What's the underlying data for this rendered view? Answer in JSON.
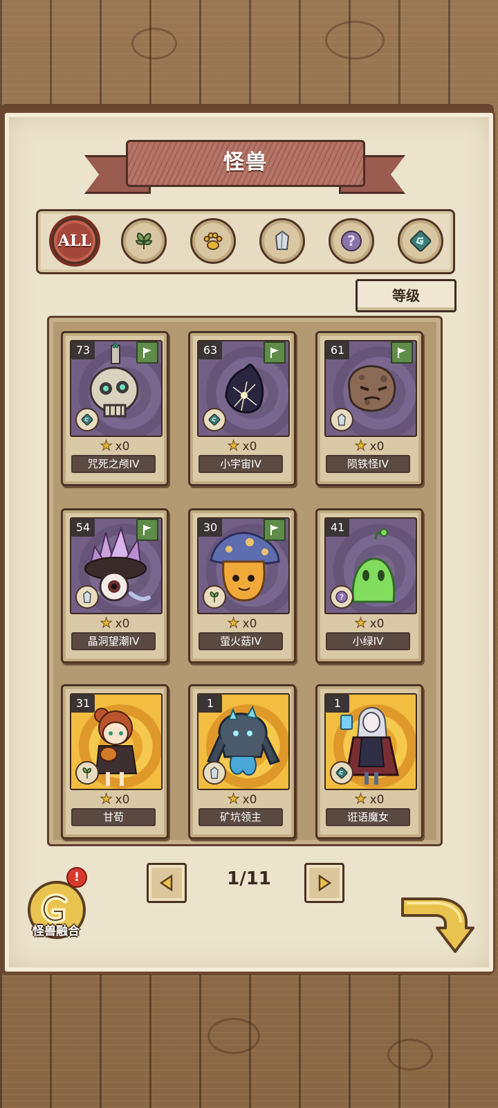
{
  "title": "怪兽",
  "tabs": [
    {
      "label": "ALL",
      "icon": "all-icon",
      "active": true
    },
    {
      "label": "",
      "icon": "leaf-icon",
      "active": false
    },
    {
      "label": "",
      "icon": "paw-icon",
      "active": false
    },
    {
      "label": "",
      "icon": "crystal-icon",
      "active": false
    },
    {
      "label": "",
      "icon": "question-icon",
      "active": false
    },
    {
      "label": "",
      "icon": "rune-icon",
      "active": false
    }
  ],
  "sort_label": "等级",
  "cards": [
    {
      "level": "73",
      "name": "咒死之颅IV",
      "count": "x0",
      "element": "rune-icon",
      "flag": true,
      "bg": "purple",
      "art": "skull"
    },
    {
      "level": "63",
      "name": "小宇宙IV",
      "count": "x0",
      "element": "rune-icon",
      "flag": true,
      "bg": "purple",
      "art": "orb"
    },
    {
      "level": "61",
      "name": "陨铁怪IV",
      "count": "x0",
      "element": "crystal-icon",
      "flag": true,
      "bg": "purple",
      "art": "rock"
    },
    {
      "level": "54",
      "name": "晶洞望潮IV",
      "count": "x0",
      "element": "crystal-icon",
      "flag": true,
      "bg": "purple",
      "art": "crystal-eye"
    },
    {
      "level": "30",
      "name": "萤火菇IV",
      "count": "x0",
      "element": "leaf-icon",
      "flag": true,
      "bg": "purple",
      "art": "mushroom"
    },
    {
      "level": "41",
      "name": "小绿IV",
      "count": "x0",
      "element": "question-icon",
      "flag": false,
      "bg": "purple",
      "art": "green-blob"
    },
    {
      "level": "31",
      "name": "甘荀",
      "count": "x0",
      "element": "leaf-icon",
      "flag": false,
      "bg": "gold",
      "art": "girl"
    },
    {
      "level": "1",
      "name": "矿坑领主",
      "count": "x0",
      "element": "crystal-icon",
      "flag": false,
      "bg": "gold",
      "art": "golem"
    },
    {
      "level": "1",
      "name": "诳语魔女",
      "count": "x0",
      "element": "rune-icon",
      "flag": false,
      "bg": "gold",
      "art": "witch"
    }
  ],
  "pagination": {
    "text": "1/11"
  },
  "fusion": {
    "label": "怪兽融合",
    "badge": "!"
  },
  "colors": {
    "accent": "#a4473b",
    "flag": "#5f8c48",
    "gold": "#e9c350"
  }
}
